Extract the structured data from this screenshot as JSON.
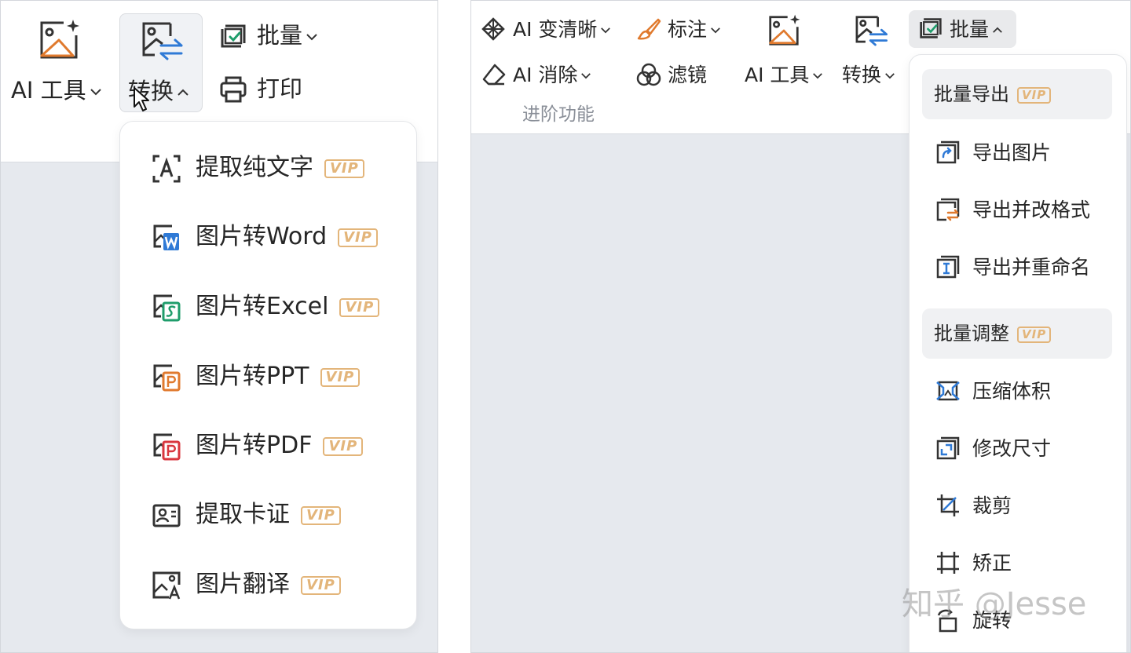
{
  "left": {
    "toolbar": {
      "ai_tools_label": "AI 工具",
      "convert_label": "转换",
      "batch_label": "批量",
      "print_label": "打印"
    },
    "convert_menu": [
      {
        "label": "提取纯文字",
        "vip": "VIP",
        "icon": "text-extract-icon"
      },
      {
        "label": "图片转Word",
        "vip": "VIP",
        "icon": "word-icon"
      },
      {
        "label": "图片转Excel",
        "vip": "VIP",
        "icon": "excel-icon"
      },
      {
        "label": "图片转PPT",
        "vip": "VIP",
        "icon": "ppt-icon"
      },
      {
        "label": "图片转PDF",
        "vip": "VIP",
        "icon": "pdf-icon"
      },
      {
        "label": "提取卡证",
        "vip": "VIP",
        "icon": "id-card-icon"
      },
      {
        "label": "图片翻译",
        "vip": "VIP",
        "icon": "translate-icon"
      }
    ]
  },
  "right": {
    "toolbar": {
      "ai_enhance_label": "AI 变清晰",
      "annotate_label": "标注",
      "ai_erase_label": "AI 消除",
      "filter_label": "滤镜",
      "ai_tools_label": "AI 工具",
      "convert_label": "转换",
      "batch_label": "批量",
      "section_label": "进阶功能"
    },
    "batch_menu": {
      "export_group": {
        "label": "批量导出",
        "vip": "VIP"
      },
      "export_items": [
        {
          "label": "导出图片",
          "icon": "export-image-icon"
        },
        {
          "label": "导出并改格式",
          "icon": "export-format-icon"
        },
        {
          "label": "导出并重命名",
          "icon": "export-rename-icon"
        }
      ],
      "adjust_group": {
        "label": "批量调整",
        "vip": "VIP"
      },
      "adjust_items": [
        {
          "label": "压缩体积",
          "icon": "compress-icon"
        },
        {
          "label": "修改尺寸",
          "icon": "resize-icon"
        },
        {
          "label": "裁剪",
          "icon": "crop-icon"
        },
        {
          "label": "矫正",
          "icon": "correct-icon"
        },
        {
          "label": "旋转",
          "icon": "rotate-icon"
        }
      ]
    }
  },
  "watermark": "知乎 @Jesse",
  "colors": {
    "vip": "#e3b57a",
    "accent_blue": "#2f7ad6",
    "accent_orange": "#e07a2e",
    "accent_green": "#1f9d6b",
    "accent_red": "#d9363e",
    "canvas_bg": "#e6e9ee"
  }
}
